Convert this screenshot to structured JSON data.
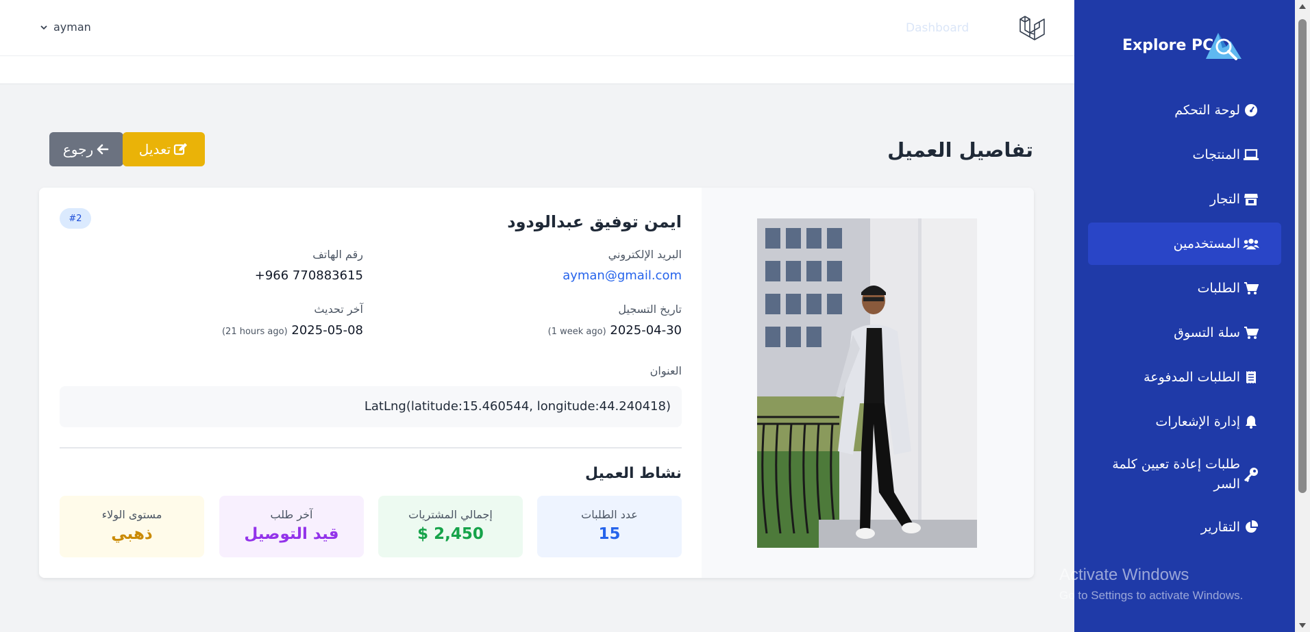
{
  "topbar": {
    "user_name": "ayman",
    "dashboard_link": "Dashboard"
  },
  "sidebar": {
    "brand": "Explore PC",
    "items": [
      {
        "label": "لوحة التحكم",
        "icon": "speedometer-icon"
      },
      {
        "label": "المنتجات",
        "icon": "laptop-icon"
      },
      {
        "label": "التجار",
        "icon": "store-icon"
      },
      {
        "label": "المستخدمين",
        "icon": "users-icon"
      },
      {
        "label": "الطلبات",
        "icon": "cart-icon"
      },
      {
        "label": "سلة التسوق",
        "icon": "cart-icon"
      },
      {
        "label": "الطلبات المدفوعة",
        "icon": "receipt-icon"
      },
      {
        "label": "إدارة الإشعارات",
        "icon": "bell-icon"
      },
      {
        "label": "طلبات إعادة تعيين كلمة السر",
        "icon": "key-icon"
      },
      {
        "label": "التقارير",
        "icon": "pie-chart-icon"
      }
    ],
    "active_index": 3
  },
  "watermark": {
    "title": "Activate Windows",
    "subtitle": "Go to Settings to activate Windows."
  },
  "page": {
    "title": "تفاصيل العميل",
    "edit_label": "تعديل",
    "back_label": "رجوع"
  },
  "customer": {
    "name": "ايمن توفيق عبدالودود",
    "id_badge": "#2",
    "email_label": "البريد الإلكتروني",
    "email": "ayman@gmail.com",
    "phone_label": "رقم الهاتف",
    "phone": "770883615 966+",
    "registered_label": "تاريخ التسجيل",
    "registered_date": "2025-04-30",
    "registered_ago": "(1 week ago)",
    "updated_label": "آخر تحديث",
    "updated_date": "2025-05-08",
    "updated_ago": "(21 hours ago)",
    "address_label": "العنوان",
    "address": "LatLng(latitude:15.460544, longitude:44.240418)"
  },
  "activity": {
    "title": "نشاط العميل",
    "stats": [
      {
        "label": "عدد الطلبات",
        "value": "15"
      },
      {
        "label": "إجمالي المشتريات",
        "value": "$ 2,450"
      },
      {
        "label": "آخر طلب",
        "value": "قيد التوصيل"
      },
      {
        "label": "مستوى الولاء",
        "value": "ذهبي"
      }
    ]
  },
  "colors": {
    "sidebar_bg": "#1f3aa8",
    "sidebar_active": "#2945c7",
    "edit_button": "#eab308",
    "back_button": "#6b7280",
    "link": "#2563eb"
  }
}
